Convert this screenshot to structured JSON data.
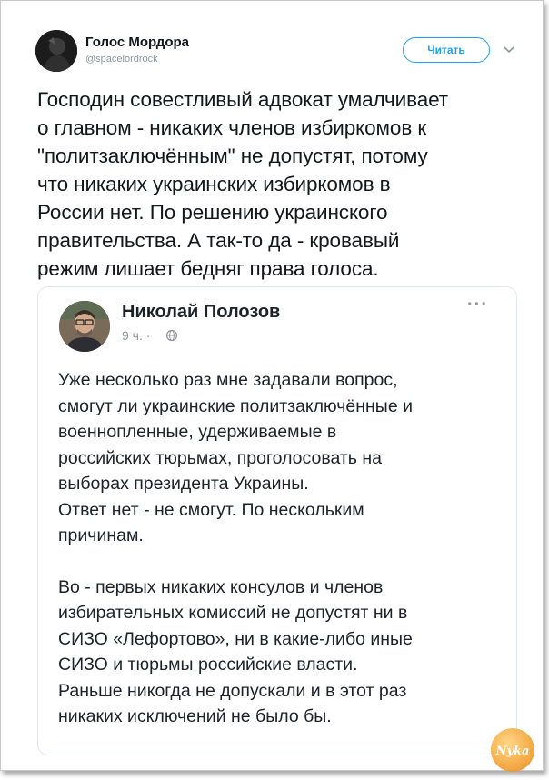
{
  "tweet": {
    "author_name": "Голос Мордора",
    "author_handle": "@spacelordrock",
    "follow_label": "Читать",
    "text": "Господин совестливый адвокат умалчивает\nо главном - никаких членов избиркомов к\n\"политзаключённым\" не допустят, потому\nчто никаких украинских избиркомов в\nРоссии нет. По решению украинского\nправительства. А так-то да - кровавый\nрежим лишает бедняг права голоса."
  },
  "quoted_post": {
    "author_name": "Николай Полозов",
    "time": "9 ч. ·",
    "more": "···",
    "paragraph1": "Уже несколько раз мне задавали вопрос,\nсмогут ли украинские политзаключённые и\nвоеннопленные, удерживаемые в\nроссийских тюрьмах, проголосовать на\nвыборах президента Украины.\nОтвет нет - не смогут. По нескольким\nпричинам.",
    "paragraph2": "Во - первых никаких консулов и членов\nизбирательных комиссий не допустят ни в\nСИЗО «Лефортово», ни в какие-либо иные\nСИЗО и тюрьмы российские власти.\nРаньше никогда не допускали и в этот раз\nникаких исключений не было бы."
  },
  "watermark": {
    "text": "Nyka"
  },
  "icons": {
    "chevron": "chevron-down-icon",
    "globe": "globe-icon"
  },
  "colors": {
    "accent": "#1da1f2",
    "muted": "#8899a6",
    "text": "#14171a"
  }
}
